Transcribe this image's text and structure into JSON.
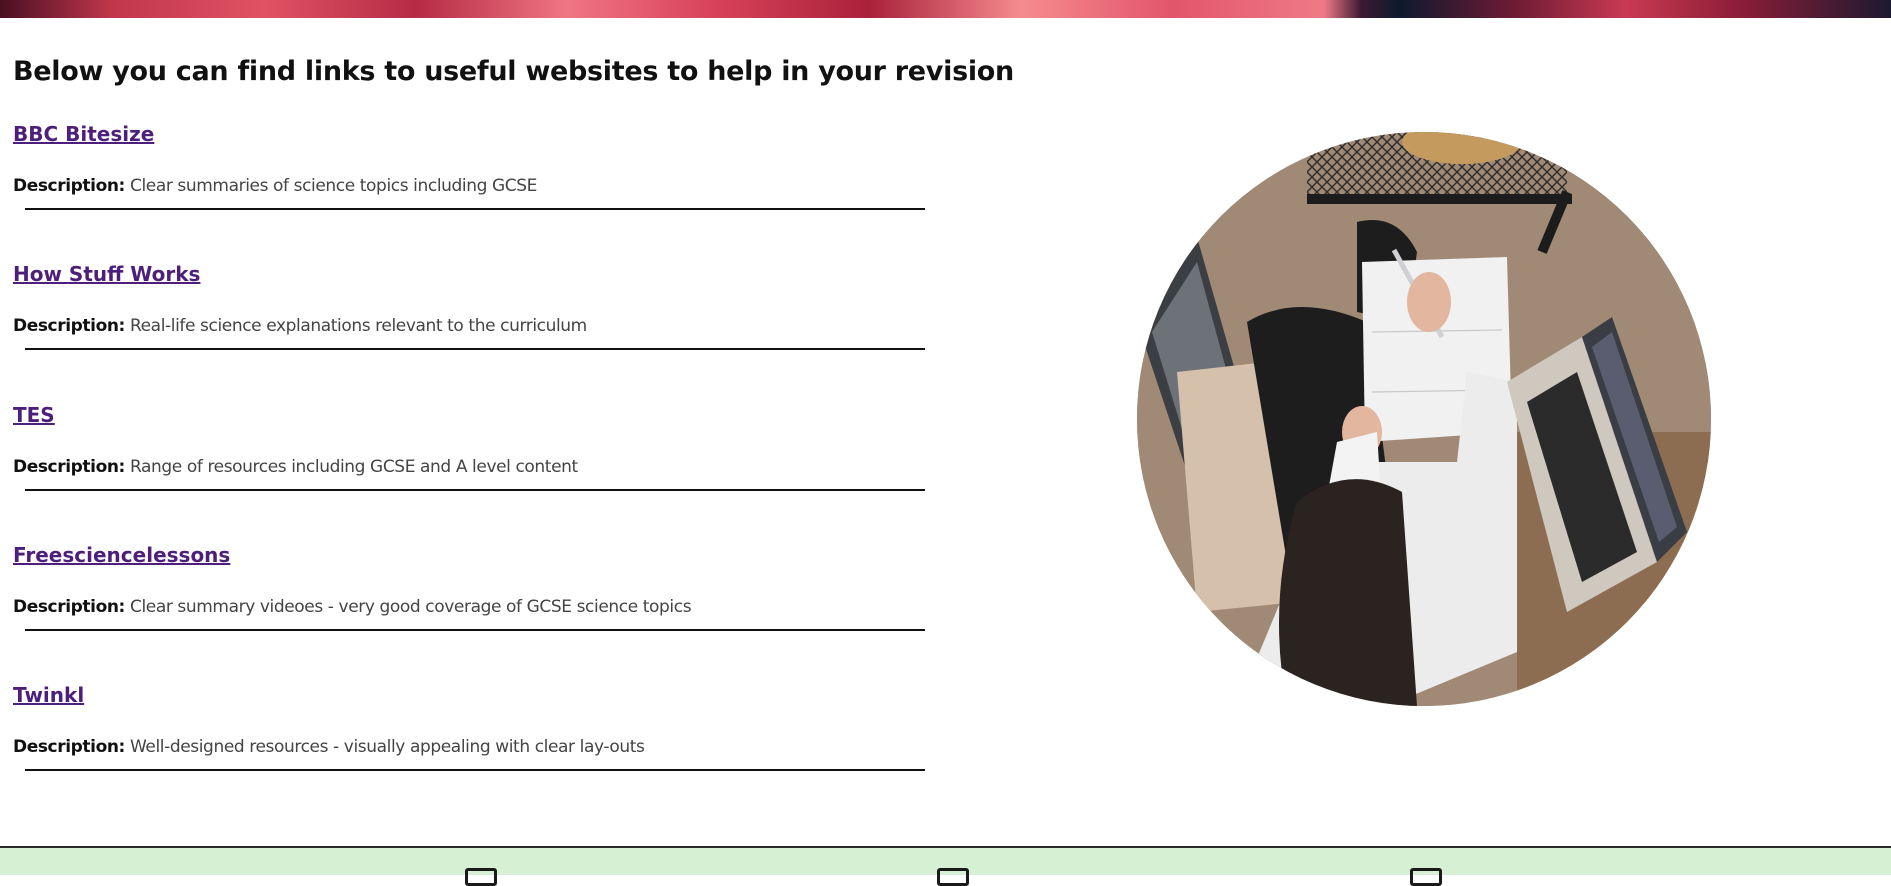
{
  "page": {
    "title": "Below you can find links to useful websites to help in your revision"
  },
  "resources": [
    {
      "name": "BBC Bitesize",
      "desc_label": "Description:",
      "desc": "Clear summaries of science topics including GCSE"
    },
    {
      "name": "How Stuff Works",
      "desc_label": "Description:",
      "desc": "Real-life science explanations relevant to the curriculum"
    },
    {
      "name": "TES",
      "desc_label": "Description:",
      "desc": "Range of resources including GCSE and A level content"
    },
    {
      "name": "Freesciencelessons",
      "desc_label": "Description:",
      "desc": "Clear summary videoes - very good coverage of GCSE science topics"
    },
    {
      "name": "Twinkl",
      "desc_label": "Description:",
      "desc": "Well-designed resources - visually appealing with clear lay-outs"
    }
  ],
  "colors": {
    "link": "#4d1f7a",
    "footer_bg": "#d6f0d4"
  },
  "icons": {
    "footer": [
      "footer-icon",
      "footer-icon",
      "footer-icon"
    ]
  }
}
